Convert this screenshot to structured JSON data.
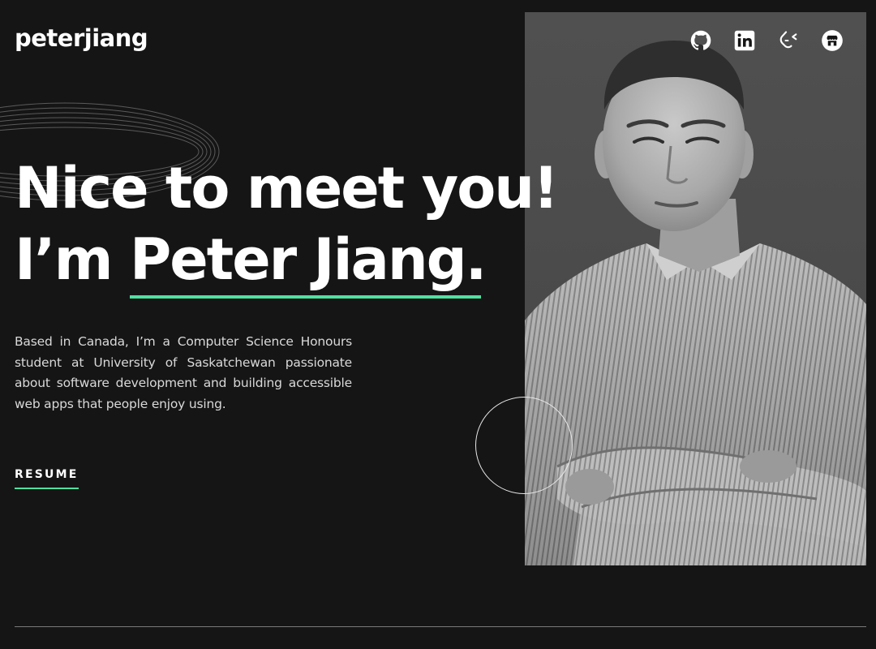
{
  "header": {
    "logo": "peterjiang",
    "socials": [
      {
        "name": "github-icon"
      },
      {
        "name": "linkedin-icon"
      },
      {
        "name": "leetcode-icon"
      },
      {
        "name": "store-icon"
      }
    ]
  },
  "hero": {
    "greeting": "Nice to meet you!",
    "intro_prefix": "I’m ",
    "name": "Peter Jiang",
    "suffix": ".",
    "description": "Based in Canada, I’m a Computer Science Honours student at University of Saskatchewan passionate about software development and building accessible web apps that people enjoy using.",
    "resume_label": "RESUME"
  },
  "colors": {
    "background": "#151515",
    "accent": "#4ee1a0",
    "text": "#ffffff"
  }
}
